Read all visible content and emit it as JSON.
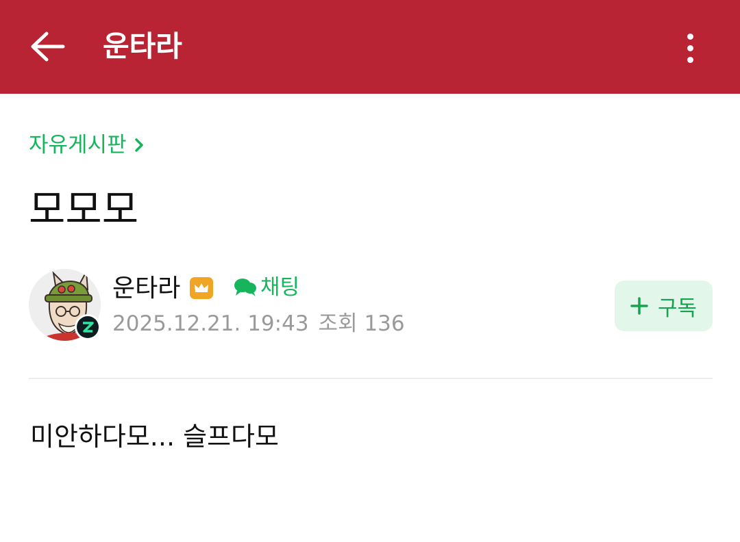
{
  "app_bar": {
    "title": "운타라",
    "background": "#b82433",
    "back_icon": "arrow-left-icon",
    "menu_icon": "more-vertical-icon"
  },
  "post": {
    "board": "자유게시판",
    "title": "모모모",
    "author": {
      "name": "운타라",
      "badge_icon": "crown-icon",
      "avatar_icon": "teemo-avatar"
    },
    "chat_label": "채팅",
    "date": "2025.12.21. 19:43",
    "views_label": "조회",
    "views": "136",
    "subscribe_label": "구독",
    "body": "미안하다모... 슬프다모"
  },
  "colors": {
    "accent_green": "#16b55c",
    "badge_orange": "#f0a524",
    "subscribe_bg": "#e3f6ea"
  }
}
